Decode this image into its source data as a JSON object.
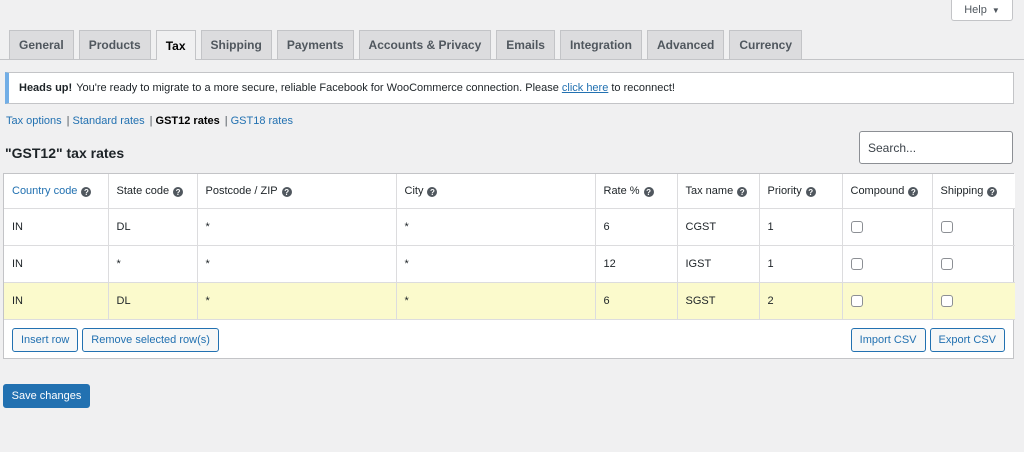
{
  "help": {
    "label": "Help",
    "caret": "▼"
  },
  "tabs": [
    "General",
    "Products",
    "Tax",
    "Shipping",
    "Payments",
    "Accounts & Privacy",
    "Emails",
    "Integration",
    "Advanced",
    "Currency"
  ],
  "active_tab": "Tax",
  "notice": {
    "strong": "Heads up!",
    "text_before": "You're ready to migrate to a more secure, reliable Facebook for WooCommerce connection. Please",
    "link": "click here",
    "text_after": "to reconnect!",
    "border_color": "#72aee6"
  },
  "subnav": {
    "items": [
      "Tax options",
      "Standard rates",
      "GST12 rates",
      "GST18 rates"
    ],
    "current": "GST12 rates",
    "separator": "|"
  },
  "page_title": "\"GST12\" tax rates",
  "search": {
    "placeholder": "Search..."
  },
  "table": {
    "columns": [
      "Country code",
      "State code",
      "Postcode / ZIP",
      "City",
      "Rate %",
      "Tax name",
      "Priority",
      "Compound",
      "Shipping"
    ],
    "help_icon": "?",
    "rows": [
      {
        "country": "IN",
        "state": "DL",
        "postcode": "*",
        "city": "*",
        "rate": "6",
        "name": "CGST",
        "priority": "1",
        "compound": false,
        "shipping": false,
        "highlight": false
      },
      {
        "country": "IN",
        "state": "*",
        "postcode": "*",
        "city": "*",
        "rate": "12",
        "name": "IGST",
        "priority": "1",
        "compound": false,
        "shipping": false,
        "highlight": false
      },
      {
        "country": "IN",
        "state": "DL",
        "postcode": "*",
        "city": "*",
        "rate": "6",
        "name": "SGST",
        "priority": "2",
        "compound": false,
        "shipping": false,
        "highlight": true
      }
    ],
    "buttons": {
      "insert_row": "Insert row",
      "remove_rows": "Remove selected row(s)",
      "import_csv": "Import CSV",
      "export_csv": "Export CSV"
    }
  },
  "save_button": "Save changes",
  "colors": {
    "primary": "#2271b1",
    "highlight_row": "#fbfacc",
    "background": "#f0f0f1"
  }
}
